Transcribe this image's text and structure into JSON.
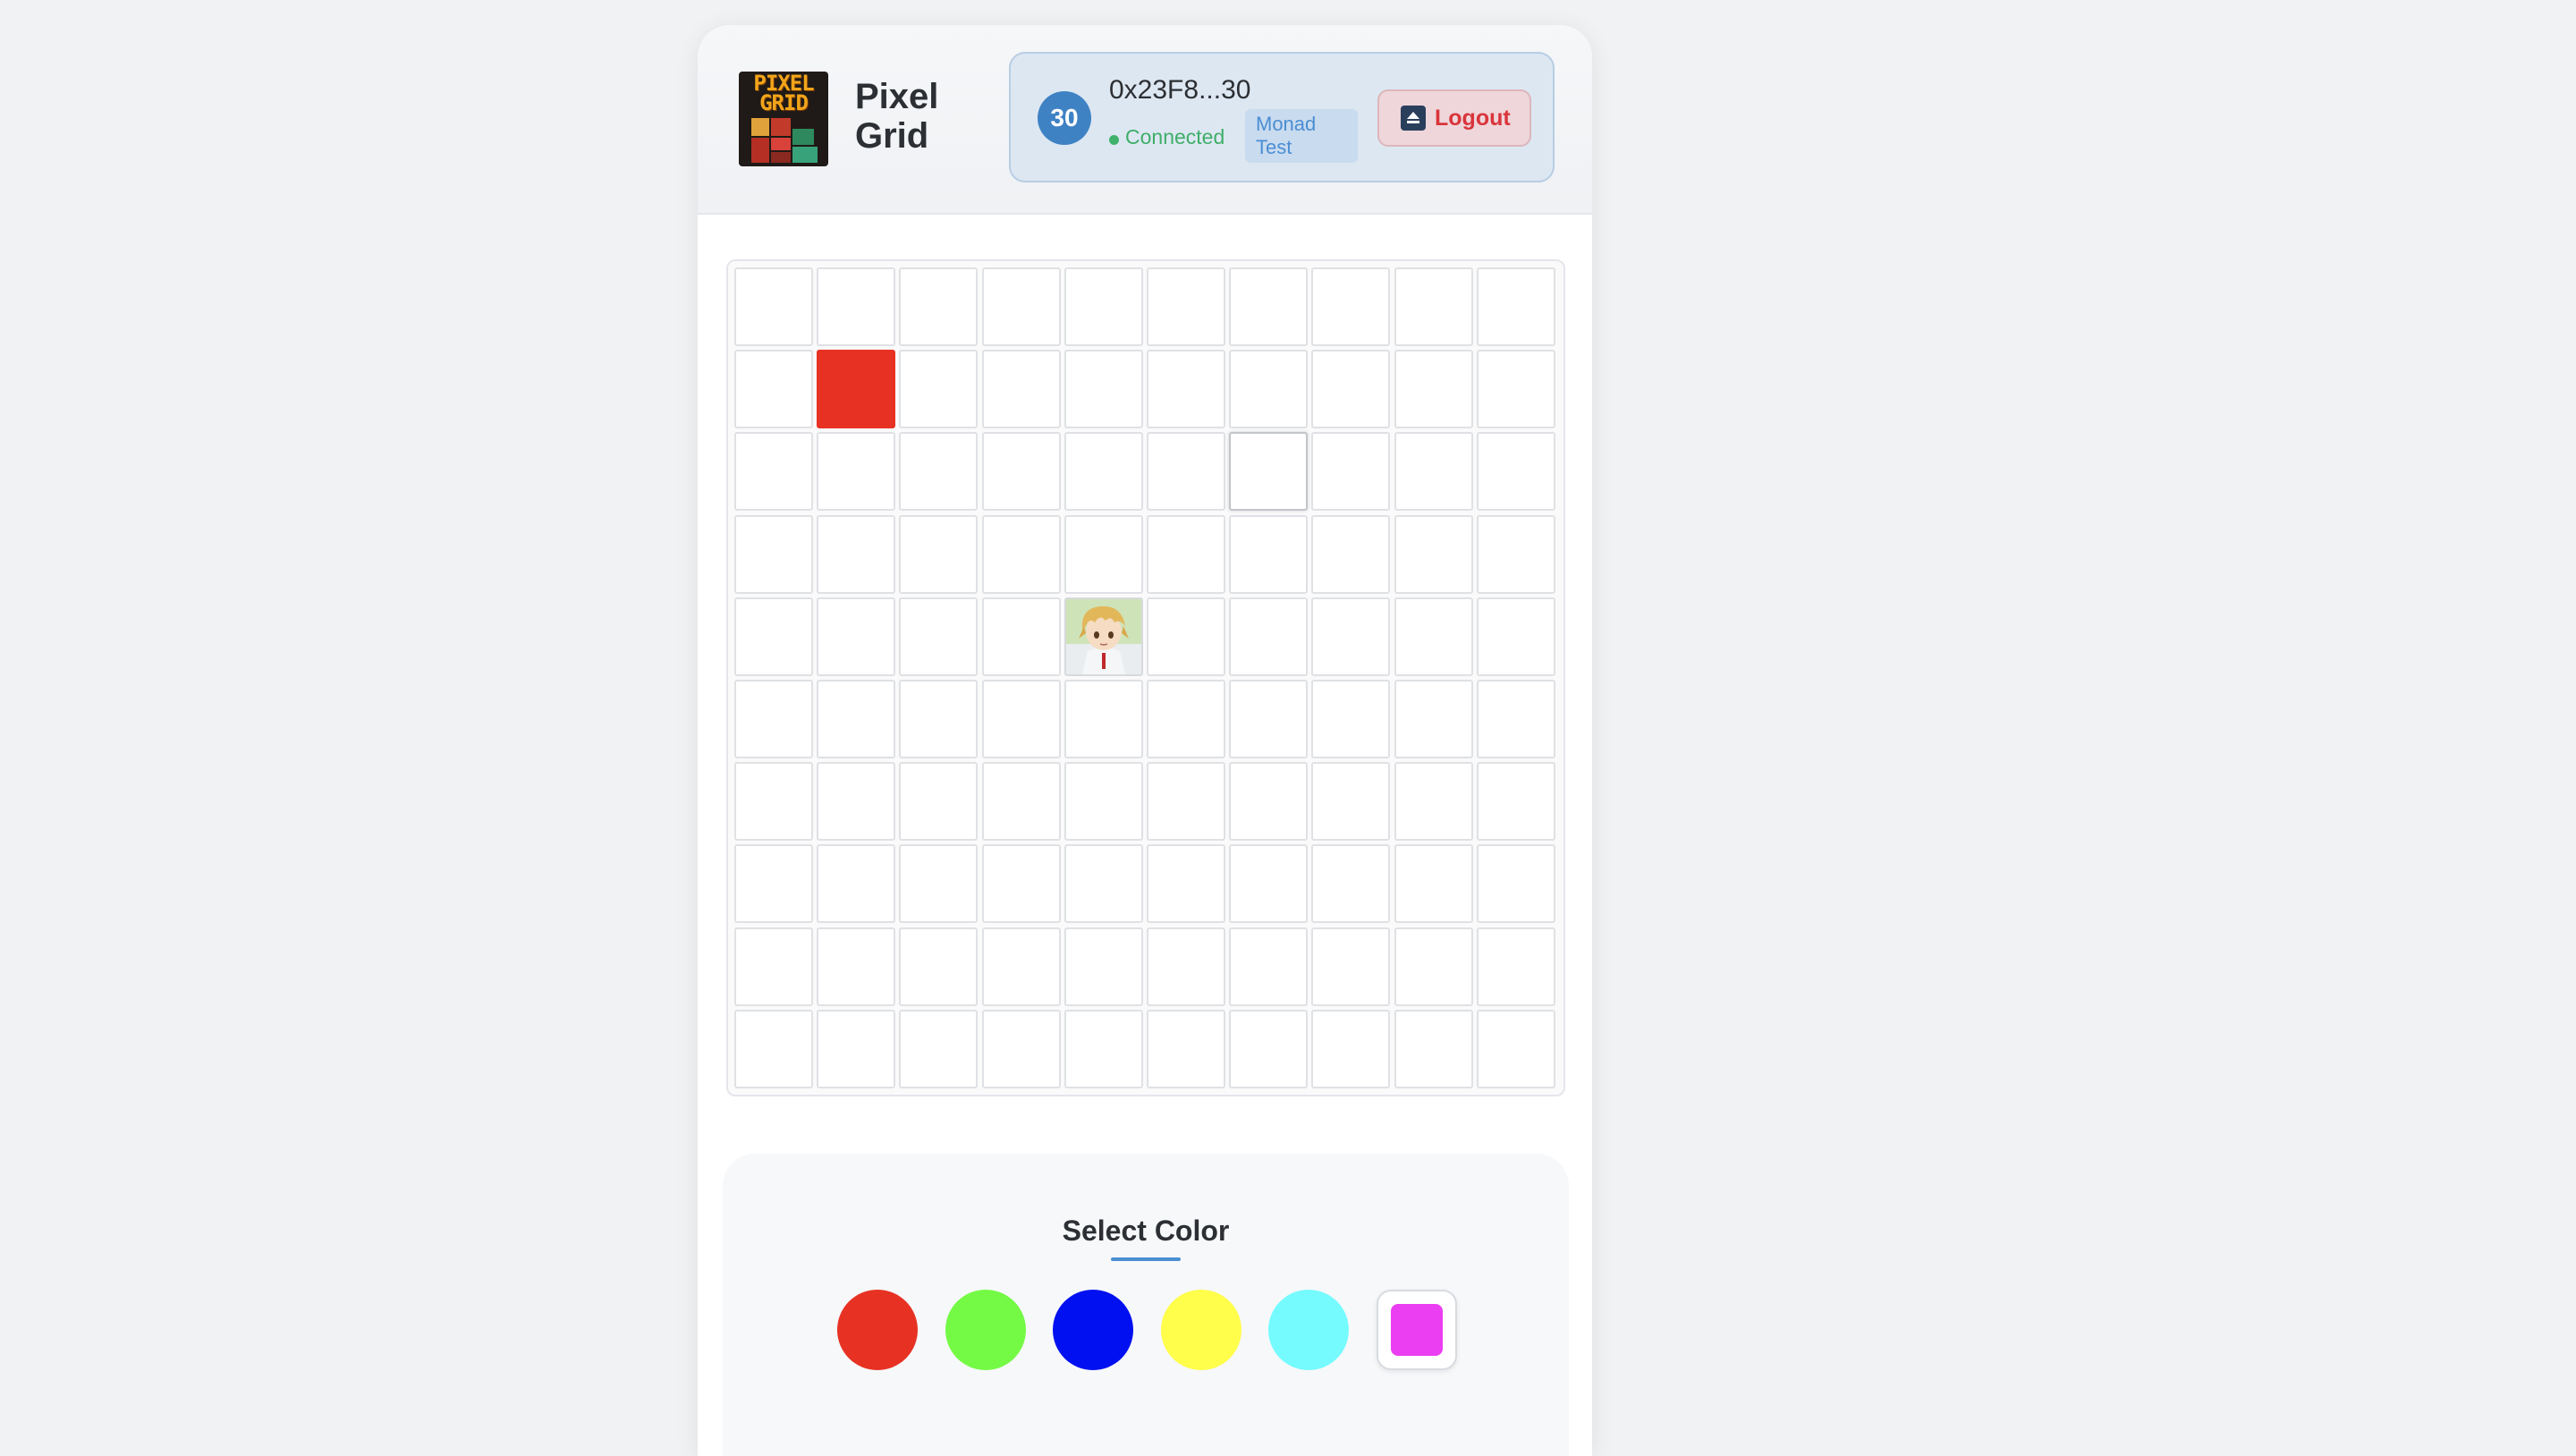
{
  "app": {
    "title": "Pixel Grid",
    "logo_text": [
      "PIXEL",
      "GRID"
    ]
  },
  "wallet": {
    "avatar_text": "30",
    "address": "0x23F8...30",
    "status": "Connected",
    "network": "Monad Test",
    "logout_label": "Logout"
  },
  "grid": {
    "rows": 10,
    "cols": 10,
    "painted": [
      {
        "row": 2,
        "col": 2,
        "type": "color",
        "color": "#e73223"
      },
      {
        "row": 5,
        "col": 5,
        "type": "image",
        "image": "anime-character-avatar"
      }
    ],
    "highlighted": [
      {
        "row": 3,
        "col": 7
      }
    ]
  },
  "palette": {
    "title": "Select Color",
    "colors": [
      {
        "name": "red",
        "hex": "#e73223"
      },
      {
        "name": "green",
        "hex": "#74fa45"
      },
      {
        "name": "blue",
        "hex": "#0010f0"
      },
      {
        "name": "yellow",
        "hex": "#fefe4b"
      },
      {
        "name": "cyan",
        "hex": "#75fbfe"
      }
    ],
    "custom": {
      "name": "magenta",
      "hex": "#eb3ef2",
      "selected": true
    }
  },
  "theme": {
    "accent": "#4a8ed3",
    "connected": "#3fae69",
    "danger": "#d9353b"
  }
}
